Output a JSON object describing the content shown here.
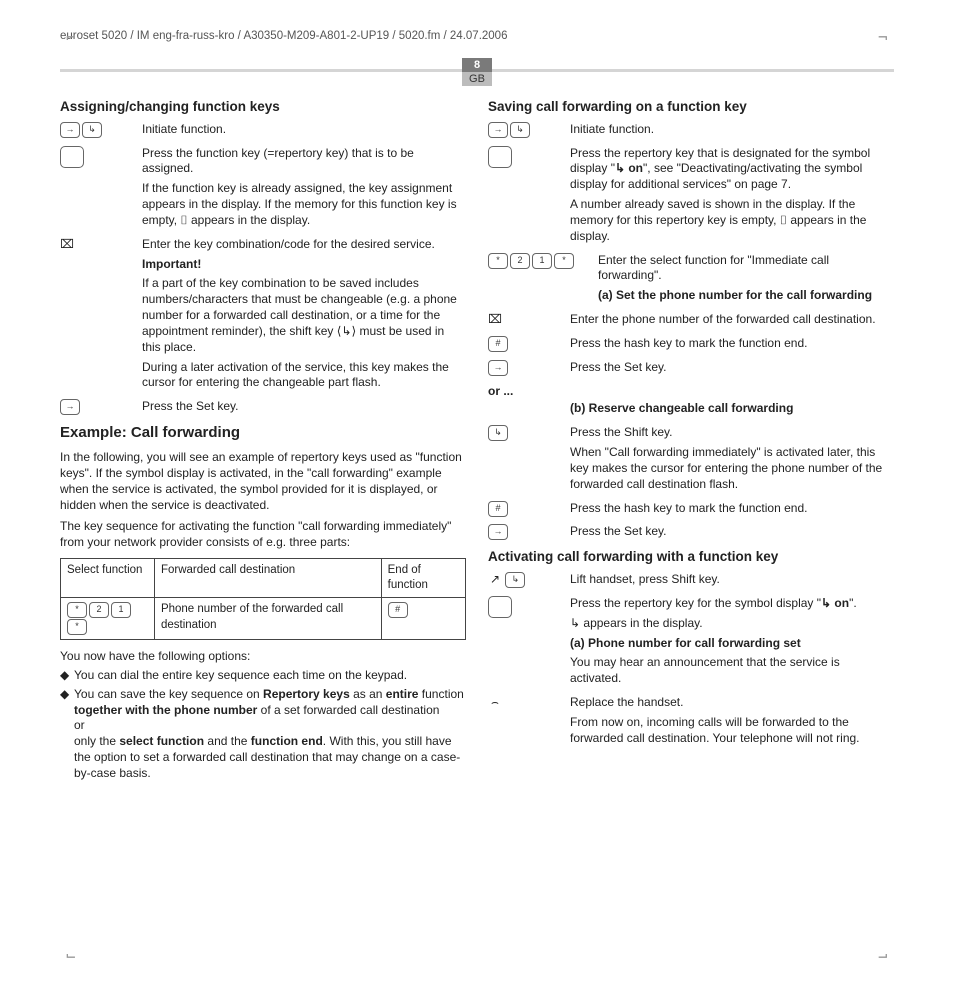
{
  "running_head": "euroset 5020 / IM eng-fra-russ-kro / A30350-M209-A801-2-UP19 / 5020.fm / 24.07.2006",
  "page_number": "8",
  "page_region": "GB",
  "left": {
    "h_assign": "Assigning/changing function keys",
    "step1": "Initiate function.",
    "step2a": "Press the function key (=repertory key) that is to be assigned.",
    "step2b": "If the function key is already assigned, the key assignment appears in the display. If the memory for this function key is empty,  ⌷ appears in the display.",
    "step3": "Enter the key combination/code for the desired service.",
    "important_h": "Important!",
    "important1": "If a part of the key combination to be saved includes numbers/characters that must be changeable (e.g. a phone number for a forwarded call destination, or a time for the appointment reminder), the shift key  ⟨↳⟩  must be used in this place.",
    "important2": "During a later activation of the service, this key makes the cursor for entering the changeable part flash.",
    "step4": "Press the Set key.",
    "h_example": "Example: Call forwarding",
    "ex_p1": "In the following, you will see an example of repertory keys used as \"function keys\". If the symbol display is activated, in the \"call forwarding\" example when the service is activated, the symbol provided for it is displayed, or hidden when the service is deactivated.",
    "ex_p2": "The key sequence for activating the function \"call forwarding immediately\" from your network provider consists of e.g. three parts:",
    "table": {
      "h1": "Select function",
      "h2": "Forwarded call destination",
      "h3": "End of function",
      "c2": "Phone number of the forwarded call destination"
    },
    "ex_p3": "You now have the following options:",
    "bul1": "You can dial the entire key sequence each time on the keypad.",
    "bul2_a": "You can save the key sequence on ",
    "bul2_b": "Repertory keys",
    "bul2_c": " as an ",
    "bul2_d": "entire",
    "bul2_e": " function ",
    "bul2_f": "together with the phone number",
    "bul2_g": " of a set forwarded call destination",
    "bul2_or": "or",
    "bul2_h1": "only the ",
    "bul2_h2": "select function",
    "bul2_h3": " and the ",
    "bul2_h4": "function end",
    "bul2_h5": ". With this, you still have the option to set a forwarded call destination that may change on a case-by-case basis."
  },
  "right": {
    "h_save": "Saving call forwarding on a function key",
    "s1": "Initiate function.",
    "s2a": "Press the repertory key that is designated for the symbol display \"",
    "s2b": "↳ on",
    "s2c": "\", see \"Deactivating/activating the symbol display for additional services\" on page 7.",
    "s2d": "A number already saved is shown in the display. If the memory for this repertory key is empty,  ⌷ appears in the display.",
    "s3": "Enter the select function for \"Immediate call forwarding\".",
    "h_a": "(a) Set the phone number for the call forwarding",
    "a1": "Enter the phone number of the forwarded call destination.",
    "a2": "Press the hash key to mark the function end.",
    "a3": "Press the Set key.",
    "or": "or ...",
    "h_b": "(b) Reserve changeable call forwarding",
    "b1": "Press the Shift key.",
    "b2": "When \"Call forwarding immediately\" is activated later, this key makes the cursor for entering the phone number of the forwarded call destination flash.",
    "b3": "Press the hash key to mark the function end.",
    "b4": "Press the Set key.",
    "h_act": "Activating call forwarding with a function key",
    "act1": "Lift handset, press Shift key.",
    "act2a": "Press the repertory key for the symbol display \"",
    "act2b": "↳ on",
    "act2c": "\".",
    "act2d": "↳  appears in the display.",
    "h_act_a": "(a)  Phone number for call forwarding set",
    "act3": "You may hear an announcement that the service is activated.",
    "act4a": "Replace the handset.",
    "act4b": "From now on, incoming calls will be forwarded to the forwarded call destination. Your telephone will not ring."
  }
}
